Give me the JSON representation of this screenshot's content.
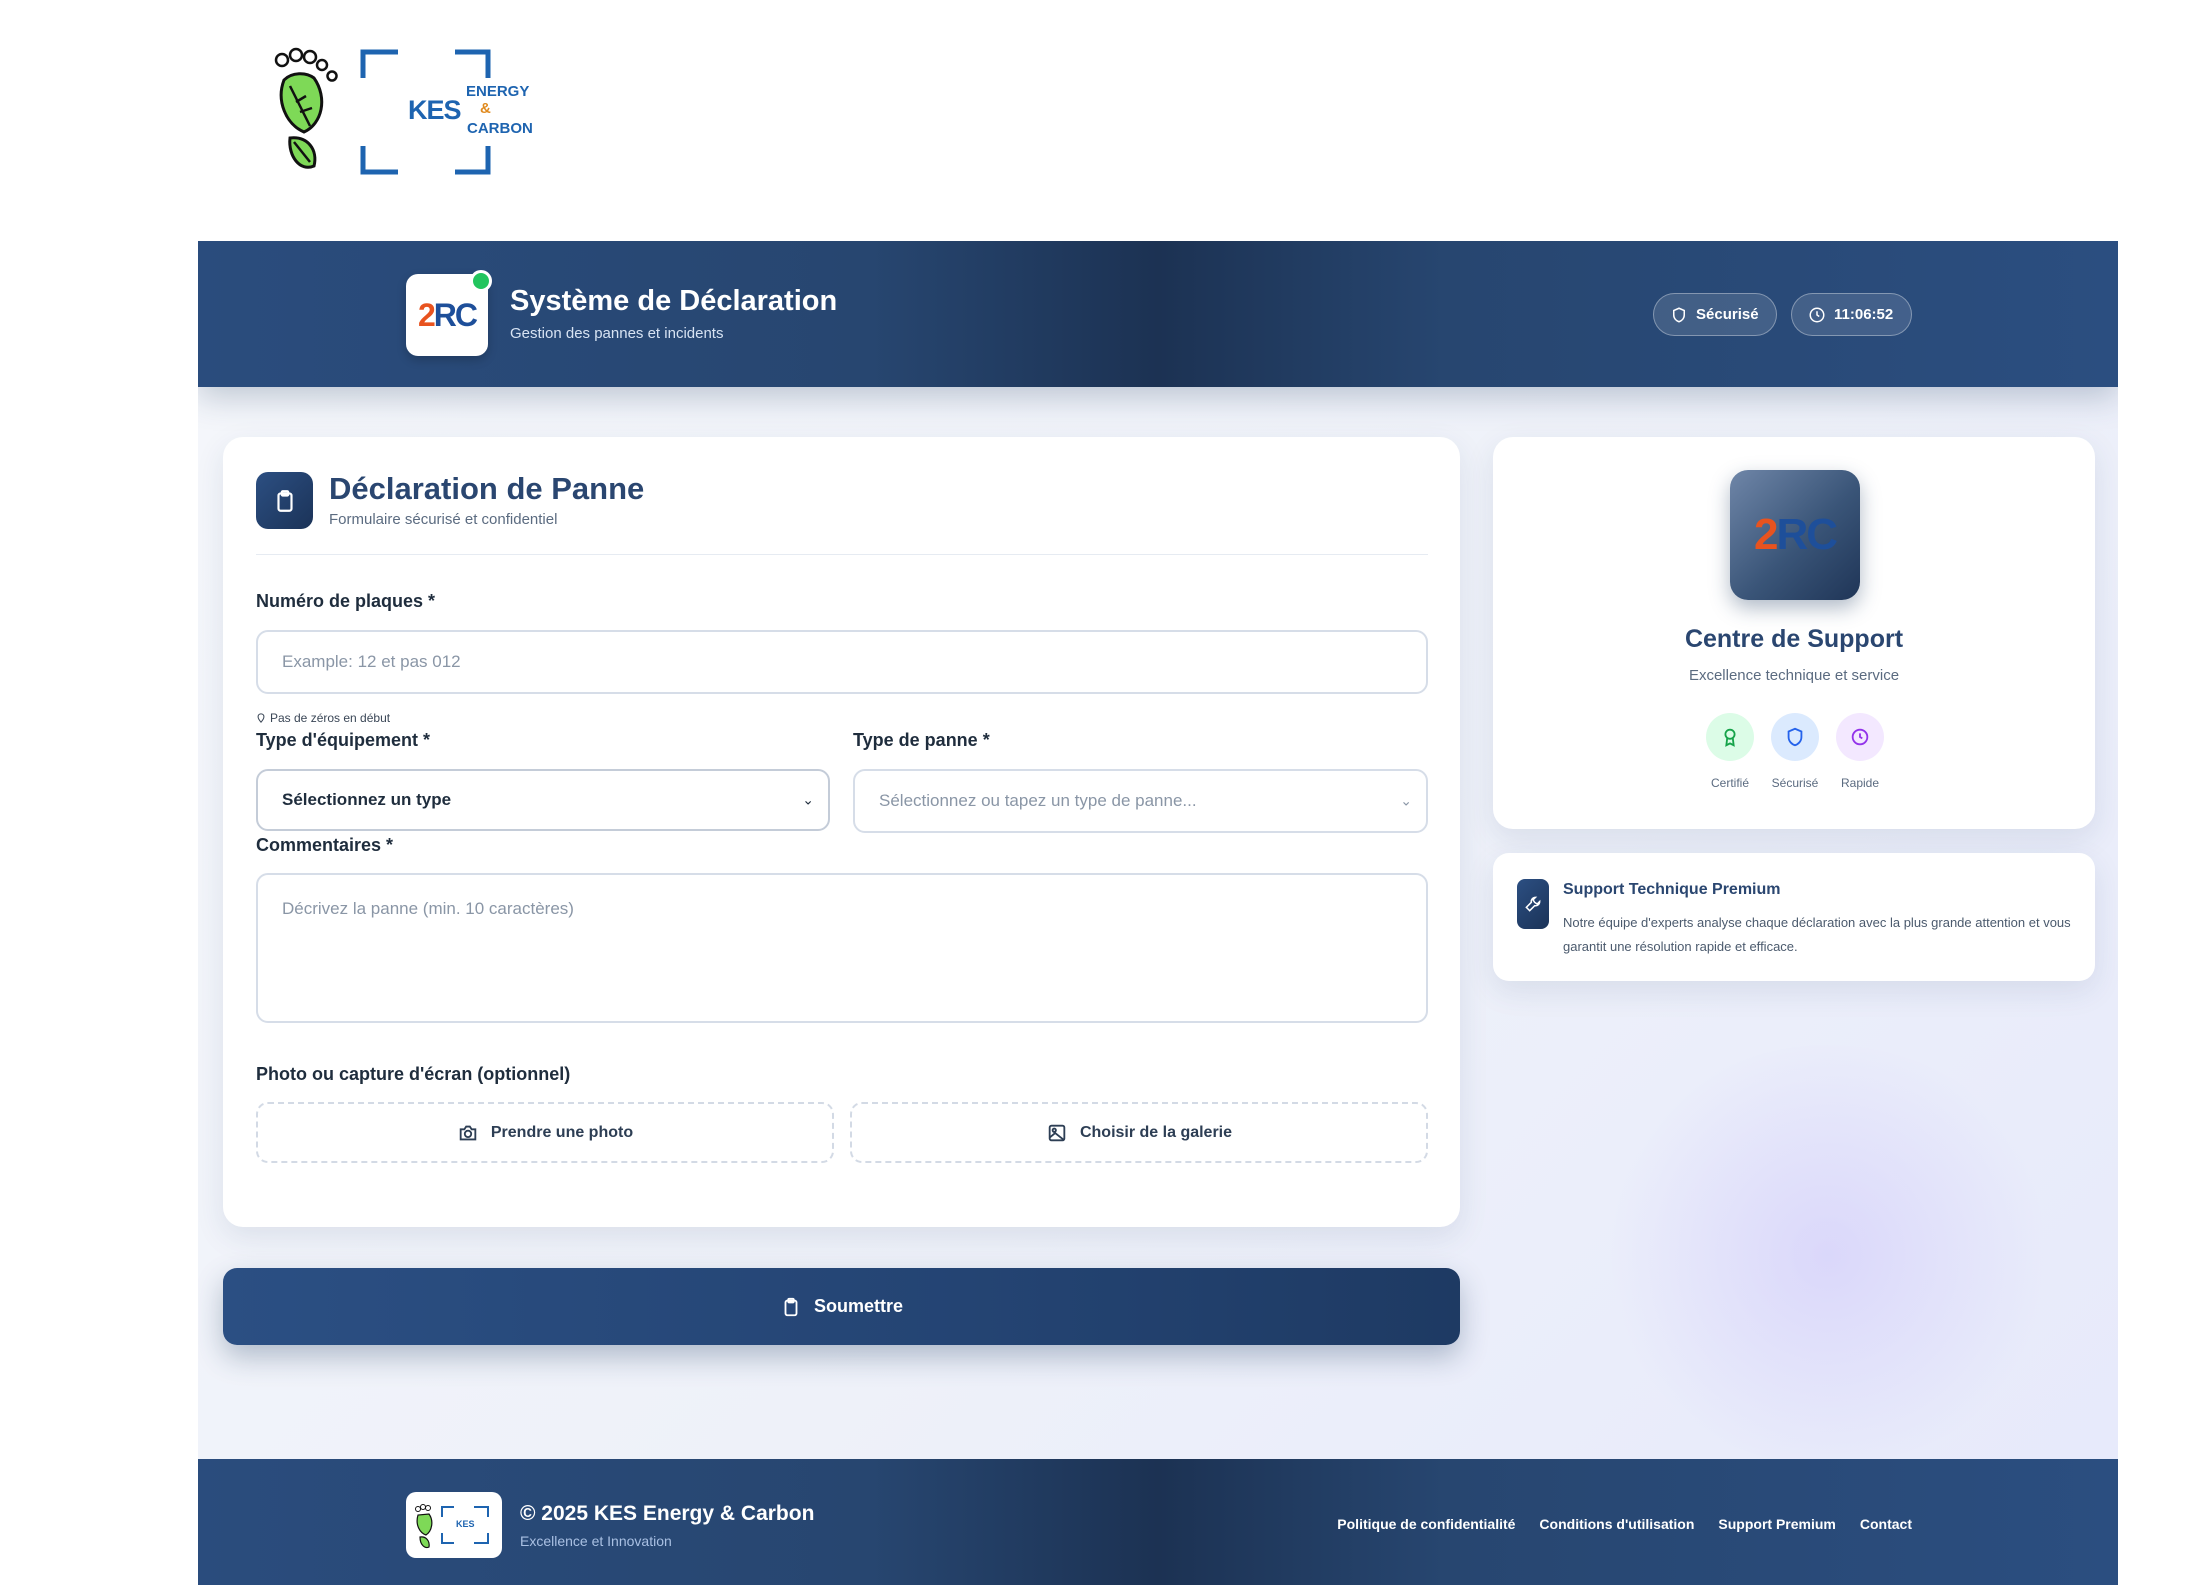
{
  "top_logo": {
    "text_main": "KES",
    "text_right": [
      "ENERGY",
      "&",
      "CARBON"
    ]
  },
  "header": {
    "brand_mark": {
      "two": "2",
      "rc": "RC"
    },
    "title": "Système de Déclaration",
    "subtitle": "Gestion des pannes et incidents",
    "secure_label": "Sécurisé",
    "time": "11:06:52"
  },
  "form": {
    "title": "Déclaration de Panne",
    "subtitle": "Formulaire sécurisé et confidentiel",
    "plate": {
      "label": "Numéro de plaques *",
      "placeholder": "Example: 12 et pas 012",
      "hint": "Pas de zéros en début"
    },
    "equipment": {
      "label": "Type d'équipement *",
      "selected": "Sélectionnez un type"
    },
    "fault": {
      "label": "Type de panne *",
      "placeholder": "Sélectionnez ou tapez un type de panne..."
    },
    "comments": {
      "label": "Commentaires *",
      "placeholder": "Décrivez la panne (min. 10 caractères)"
    },
    "photo": {
      "label": "Photo ou capture d'écran (optionnel)",
      "take_photo": "Prendre une photo",
      "gallery": "Choisir de la galerie"
    },
    "submit": "Soumettre"
  },
  "support": {
    "title": "Centre de Support",
    "subtitle": "Excellence technique et service",
    "badges": [
      {
        "label": "Certifié",
        "icon": "award-icon",
        "bg": "#dcfce7",
        "color": "#16a34a"
      },
      {
        "label": "Sécurisé",
        "icon": "shield-icon",
        "bg": "#dbeafe",
        "color": "#2563eb"
      },
      {
        "label": "Rapide",
        "icon": "clock-icon",
        "bg": "#f3e8ff",
        "color": "#9333ea"
      }
    ]
  },
  "premium": {
    "title": "Support Technique Premium",
    "text": "Notre équipe d'experts analyse chaque déclaration avec la plus grande attention et vous garantit une résolution rapide et efficace."
  },
  "footer": {
    "title": "© 2025 KES Energy & Carbon",
    "subtitle": "Excellence et Innovation",
    "links": [
      "Politique de confidentialité",
      "Conditions d'utilisation",
      "Support Premium",
      "Contact"
    ]
  },
  "colors": {
    "primary": "#1e3a5f",
    "accent_green": "#22c55e",
    "brand_orange": "#e8531f",
    "brand_blue": "#1e4f9a"
  }
}
